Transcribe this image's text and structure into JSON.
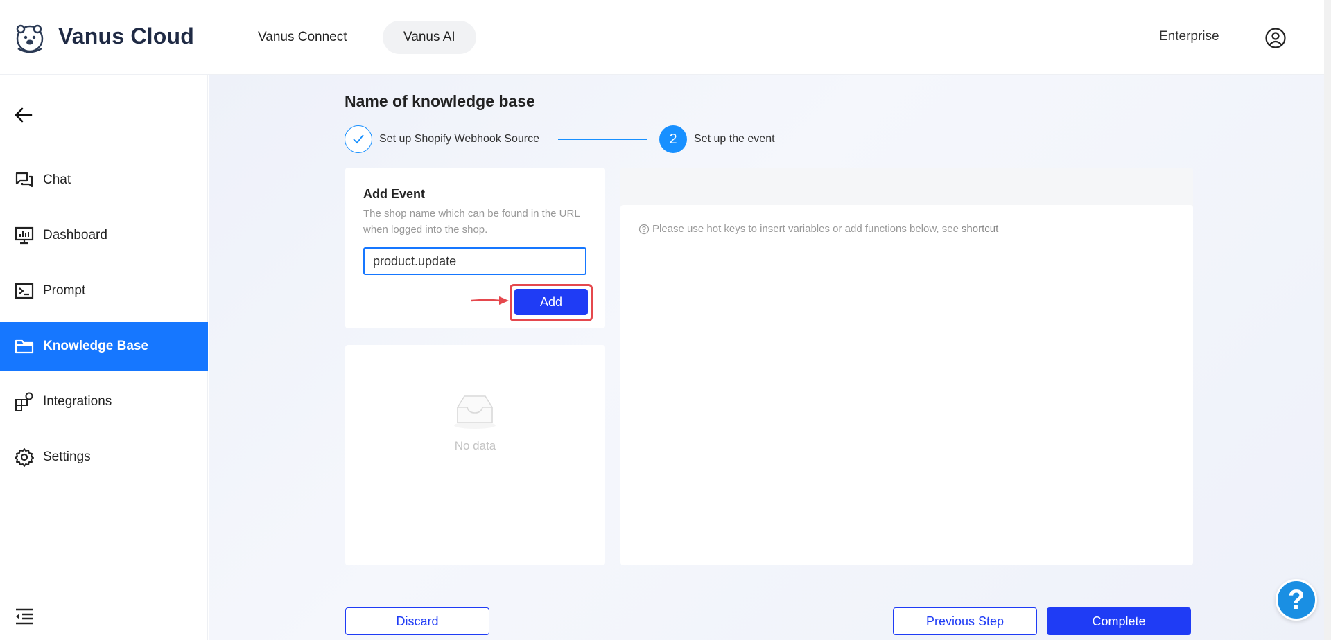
{
  "header": {
    "brand": "Vanus Cloud",
    "tabs": [
      {
        "label": "Vanus Connect"
      },
      {
        "label": "Vanus AI"
      }
    ],
    "plan": "Enterprise"
  },
  "sidebar": {
    "items": [
      {
        "label": "Chat",
        "icon": "chat-icon"
      },
      {
        "label": "Dashboard",
        "icon": "dashboard-icon"
      },
      {
        "label": "Prompt",
        "icon": "terminal-icon"
      },
      {
        "label": "Knowledge Base",
        "icon": "folder-icon",
        "active": true
      },
      {
        "label": "Integrations",
        "icon": "integrations-icon"
      },
      {
        "label": "Settings",
        "icon": "gear-icon"
      }
    ]
  },
  "main": {
    "title": "Name of knowledge base",
    "steps": [
      {
        "number": "1",
        "label": "Set up Shopify Webhook Source",
        "status": "done"
      },
      {
        "number": "2",
        "label": "Set up the event",
        "status": "current"
      }
    ],
    "add_event": {
      "title": "Add Event",
      "description": "The shop name which can be found in the URL when logged into the shop.",
      "input_value": "product.update",
      "add_label": "Add"
    },
    "list": {
      "empty_text": "No data"
    },
    "editor": {
      "hint": "Please use hot keys to insert variables or add functions below, see",
      "hint_link": "shortcut"
    },
    "footer": {
      "discard_label": "Discard",
      "previous_label": "Previous Step",
      "complete_label": "Complete"
    }
  },
  "help": {
    "label": "?"
  },
  "colors": {
    "primary": "#1f3cf5",
    "accent": "#1677ff",
    "highlight": "#e5484d"
  }
}
